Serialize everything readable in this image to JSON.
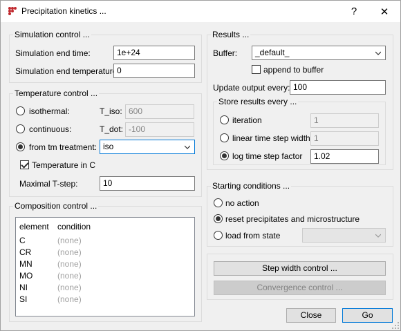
{
  "window": {
    "title": "Precipitation kinetics ...",
    "help_glyph": "?",
    "close_glyph": "✕"
  },
  "simulation": {
    "legend": "Simulation control ...",
    "end_time_label": "Simulation end time:",
    "end_time_value": "1e+24",
    "end_temp_label": "Simulation end temperature:",
    "end_temp_value": "0"
  },
  "temperature": {
    "legend": "Temperature control ...",
    "isothermal_label": "isothermal:",
    "t_iso_label": "T_iso:",
    "t_iso_value": "600",
    "continuous_label": "continuous:",
    "t_dot_label": "T_dot:",
    "t_dot_value": "-100",
    "from_tm_label": "from tm treatment:",
    "tm_value": "iso",
    "temp_in_c_label": "Temperature in C",
    "max_tstep_label": "Maximal T-step:",
    "max_tstep_value": "10",
    "selected": "from tm treatment"
  },
  "composition": {
    "legend": "Composition control ...",
    "columns": [
      "element",
      "condition"
    ],
    "rows": [
      {
        "element": "C",
        "condition": "(none)"
      },
      {
        "element": "CR",
        "condition": "(none)"
      },
      {
        "element": "MN",
        "condition": "(none)"
      },
      {
        "element": "MO",
        "condition": "(none)"
      },
      {
        "element": "NI",
        "condition": "(none)"
      },
      {
        "element": "SI",
        "condition": "(none)"
      }
    ]
  },
  "results": {
    "legend": "Results ...",
    "buffer_label": "Buffer:",
    "buffer_value": "_default_",
    "append_label": "append to buffer",
    "update_label": "Update output every:",
    "update_value": "100",
    "store_legend": "Store results every ...",
    "iteration_label": "iteration",
    "iteration_value": "1",
    "linear_label": "linear time step width",
    "linear_value": "1",
    "log_label": "log time step factor",
    "log_value": "1.02",
    "selected": "log time step factor"
  },
  "starting": {
    "legend": "Starting conditions ...",
    "no_action_label": "no action",
    "reset_label": "reset precipitates and microstructure",
    "load_label": "load from state",
    "load_value": "",
    "selected": "reset precipitates and microstructure"
  },
  "actions": {
    "step_width_label": "Step width control ...",
    "convergence_label": "Convergence control ...",
    "close_label": "Close",
    "go_label": "Go"
  },
  "colors": {
    "accent": "#0078d7",
    "disabled_text": "#838383",
    "window_bg": "#f0f0f0"
  }
}
